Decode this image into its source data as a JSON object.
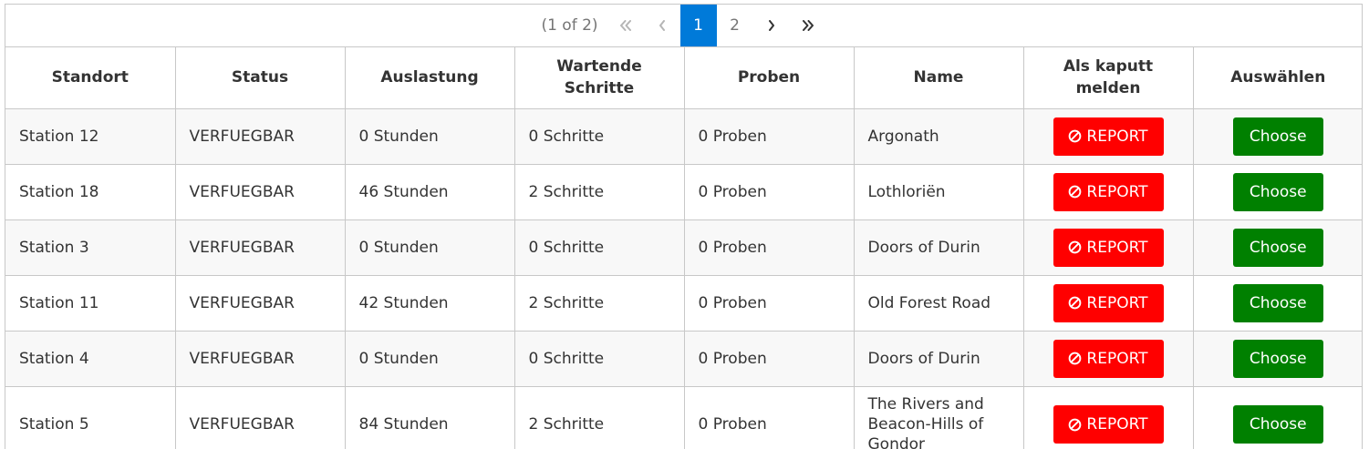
{
  "paginator": {
    "report": "(1 of 2)",
    "pages": [
      "1",
      "2"
    ],
    "current_page": "1",
    "icons": {
      "first": "double-chevron-left-icon",
      "prev": "chevron-left-icon",
      "next": "chevron-right-icon",
      "last": "double-chevron-right-icon"
    }
  },
  "table": {
    "headers": {
      "standort": "Standort",
      "status": "Status",
      "auslastung": "Auslastung",
      "wartende_schritte": "Wartende Schritte",
      "proben": "Proben",
      "name": "Name",
      "als_kaputt_melden": "Als kaputt melden",
      "auswaehlen": "Auswählen"
    },
    "rows": [
      {
        "standort": "Station 12",
        "status": "VERFUEGBAR",
        "auslastung": "0 Stunden",
        "schritte": "0 Schritte",
        "proben": "0 Proben",
        "name": "Argonath",
        "report": "REPORT",
        "choose": "Choose"
      },
      {
        "standort": "Station 18",
        "status": "VERFUEGBAR",
        "auslastung": "46 Stunden",
        "schritte": "2 Schritte",
        "proben": "0 Proben",
        "name": "Lothloriën",
        "report": "REPORT",
        "choose": "Choose"
      },
      {
        "standort": "Station 3",
        "status": "VERFUEGBAR",
        "auslastung": "0 Stunden",
        "schritte": "0 Schritte",
        "proben": "0 Proben",
        "name": "Doors of Durin",
        "report": "REPORT",
        "choose": "Choose"
      },
      {
        "standort": "Station 11",
        "status": "VERFUEGBAR",
        "auslastung": "42 Stunden",
        "schritte": "2 Schritte",
        "proben": "0 Proben",
        "name": "Old Forest Road",
        "report": "REPORT",
        "choose": "Choose"
      },
      {
        "standort": "Station 4",
        "status": "VERFUEGBAR",
        "auslastung": "0 Stunden",
        "schritte": "0 Schritte",
        "proben": "0 Proben",
        "name": "Doors of Durin",
        "report": "REPORT",
        "choose": "Choose"
      },
      {
        "standort": "Station 5",
        "status": "VERFUEGBAR",
        "auslastung": "84 Stunden",
        "schritte": "2 Schritte",
        "proben": "0 Proben",
        "name": "The Rivers and Beacon-Hills of Gondor",
        "report": "REPORT",
        "choose": "Choose"
      }
    ],
    "report_icon": "ban-icon"
  },
  "colors": {
    "accent": "#007ad9",
    "report_button": "#ff0000",
    "choose_button": "#008000",
    "border": "#c8c8c8",
    "row_stripe": "#f8f8f8"
  }
}
